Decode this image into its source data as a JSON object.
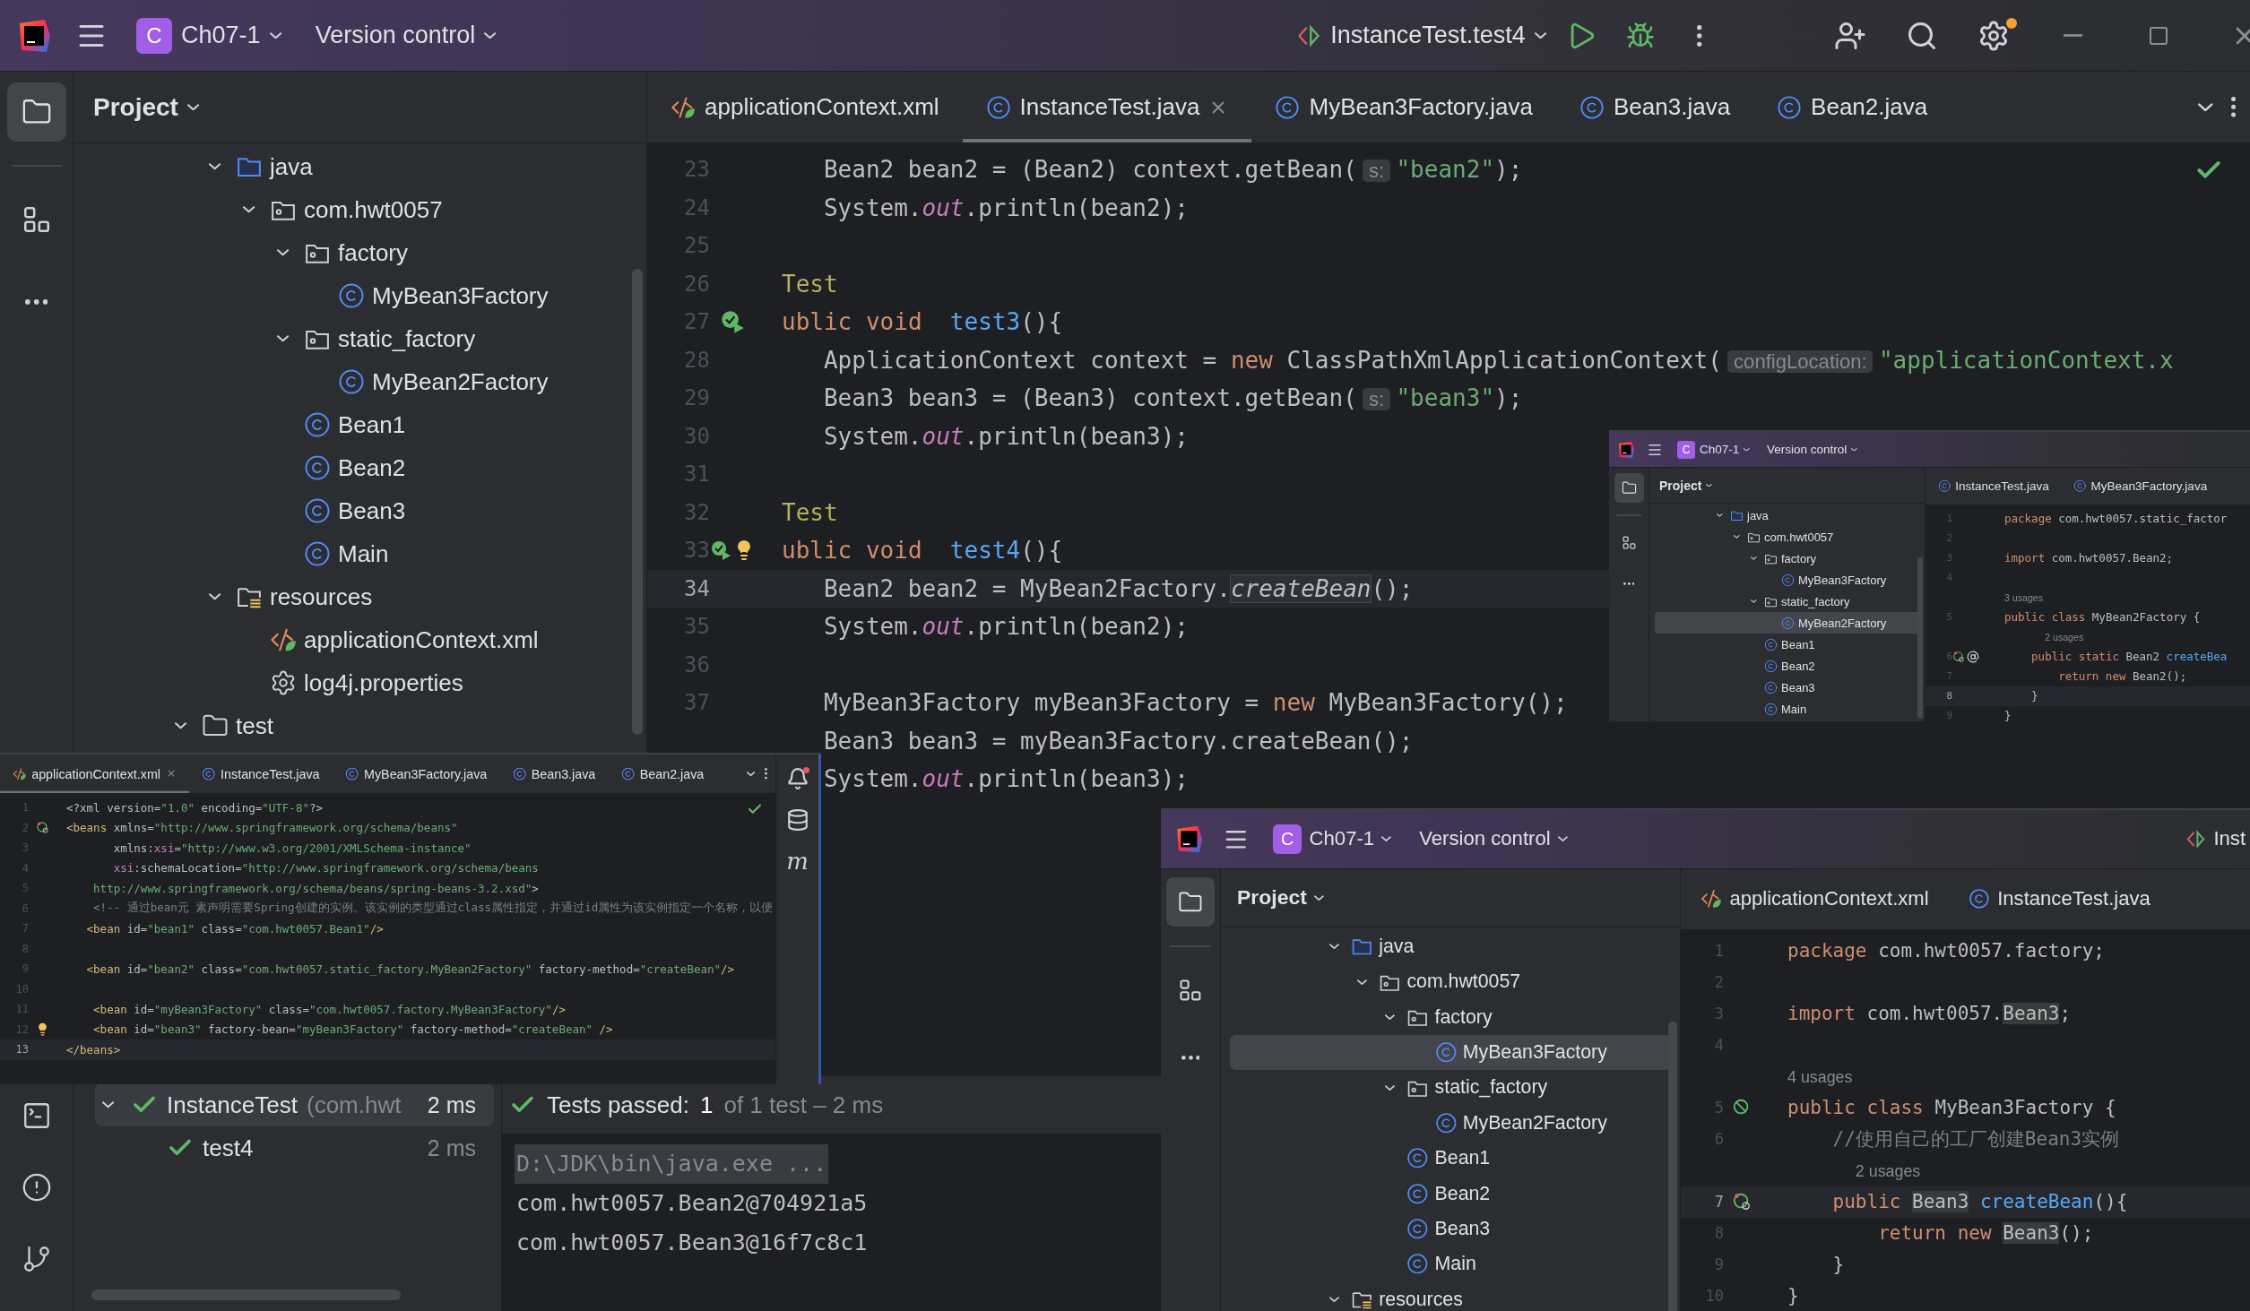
{
  "title_bar": {
    "project_badge": "C",
    "project": "Ch07-1",
    "vcs": "Version control",
    "run_config": "InstanceTest.test4"
  },
  "project_panel": {
    "title": "Project",
    "tree": [
      {
        "children": [
          {
            "label": "java",
            "kind": "source_folder",
            "expanded": true,
            "selected": false,
            "children": [
              {
                "label": "com.hwt0057",
                "kind": "package",
                "expanded": true,
                "selected": false,
                "children": [
                  {
                    "label": "factory",
                    "kind": "package",
                    "expanded": true,
                    "selected": false,
                    "children": [
                      {
                        "label": "MyBean3Factory",
                        "kind": "class",
                        "selected": false
                      }
                    ]
                  },
                  {
                    "label": "static_factory",
                    "kind": "package",
                    "expanded": true,
                    "selected": false,
                    "children": [
                      {
                        "label": "MyBean2Factory",
                        "kind": "class",
                        "selected": false
                      }
                    ]
                  },
                  {
                    "label": "Bean1",
                    "kind": "class",
                    "selected": false
                  },
                  {
                    "label": "Bean2",
                    "kind": "class",
                    "selected": false
                  },
                  {
                    "label": "Bean3",
                    "kind": "class",
                    "selected": false
                  },
                  {
                    "label": "Main",
                    "kind": "class",
                    "selected": false
                  }
                ]
              }
            ]
          },
          {
            "label": "resources",
            "kind": "resource_folder",
            "expanded": true,
            "selected": false,
            "children": [
              {
                "label": "applicationContext.xml",
                "kind": "xml",
                "selected": false
              },
              {
                "label": "log4j.properties",
                "kind": "properties",
                "selected": false
              }
            ]
          }
        ]
      },
      {
        "label": "test",
        "kind": "folder",
        "expanded": true,
        "selected": false
      }
    ]
  },
  "editor": {
    "tabs": [
      {
        "label": "applicationContext.xml",
        "kind": "xml",
        "selected": false
      },
      {
        "label": "InstanceTest.java",
        "kind": "class",
        "selected": true
      },
      {
        "label": "MyBean3Factory.java",
        "kind": "class",
        "selected": false
      },
      {
        "label": "Bean3.java",
        "kind": "class",
        "selected": false
      },
      {
        "label": "Bean2.java",
        "kind": "class",
        "selected": false
      }
    ],
    "lines": [
      {
        "number": "23",
        "current": false,
        "tokens": [
          {
            "kind": "plain",
            "text": "   Bean2 bean2 = (Bean2) context.getBean("
          },
          {
            "kind": "hint",
            "text": "s:"
          },
          {
            "kind": "str",
            "text": "\"bean2\""
          },
          {
            "kind": "plain",
            "text": ");"
          }
        ]
      },
      {
        "number": "24",
        "current": false,
        "tokens": [
          {
            "kind": "plain",
            "text": "   System."
          },
          {
            "kind": "field",
            "text": "out"
          },
          {
            "kind": "plain",
            "text": ".println(bean2);"
          }
        ]
      },
      {
        "number": "25",
        "current": false
      },
      {
        "number": "26",
        "current": false,
        "tokens": [
          {
            "kind": "ann",
            "text": "Test"
          }
        ]
      },
      {
        "number": "27",
        "current": false,
        "markers": [
          {
            "kind": "run"
          }
        ],
        "tokens": [
          {
            "kind": "kw",
            "text": "ublic void  "
          },
          {
            "kind": "decl",
            "text": "test3"
          },
          {
            "kind": "plain",
            "text": "(){"
          }
        ]
      },
      {
        "number": "28",
        "current": false,
        "tokens": [
          {
            "kind": "plain",
            "text": "   ApplicationContext context = "
          },
          {
            "kind": "kw",
            "text": "new "
          },
          {
            "kind": "plain",
            "text": "ClassPathXmlApplicationContext("
          },
          {
            "kind": "hint",
            "text": "configLocation:"
          },
          {
            "kind": "str",
            "text": "\"applicationContext.x"
          }
        ]
      },
      {
        "number": "29",
        "current": false,
        "tokens": [
          {
            "kind": "plain",
            "text": "   Bean3 bean3 = (Bean3) context.getBean("
          },
          {
            "kind": "hint",
            "text": "s:"
          },
          {
            "kind": "str",
            "text": "\"bean3\""
          },
          {
            "kind": "plain",
            "text": ");"
          }
        ]
      },
      {
        "number": "30",
        "current": false,
        "tokens": [
          {
            "kind": "plain",
            "text": "   System."
          },
          {
            "kind": "field",
            "text": "out"
          },
          {
            "kind": "plain",
            "text": ".println(bean3);"
          }
        ]
      },
      {
        "number": "31",
        "current": false
      },
      {
        "number": "32",
        "current": false,
        "tokens": [
          {
            "kind": "ann",
            "text": "Test"
          }
        ]
      },
      {
        "number": "33",
        "current": false,
        "markers": [
          {
            "kind": "run"
          },
          {
            "kind": "bulb"
          }
        ],
        "tokens": [
          {
            "kind": "kw",
            "text": "ublic void  "
          },
          {
            "kind": "decl",
            "text": "test4"
          },
          {
            "kind": "plain",
            "text": "(){"
          }
        ]
      },
      {
        "number": "34",
        "current": true,
        "tokens": [
          {
            "kind": "plain",
            "text": "   Bean2 bean2 = MyBean2Factory."
          },
          {
            "kind": "call",
            "text": "createBean"
          },
          {
            "kind": "plain",
            "text": "();"
          }
        ]
      },
      {
        "number": "35",
        "current": false,
        "tokens": [
          {
            "kind": "plain",
            "text": "   System."
          },
          {
            "kind": "field",
            "text": "out"
          },
          {
            "kind": "plain",
            "text": ".println(bean2);"
          }
        ]
      },
      {
        "number": "36",
        "current": false
      },
      {
        "number": "37",
        "current": false,
        "tokens": [
          {
            "kind": "plain",
            "text": "   MyBean3Factory myBean3Factory = "
          },
          {
            "kind": "kw",
            "text": "new "
          },
          {
            "kind": "plain",
            "text": "MyBean3Factory();"
          }
        ]
      },
      {
        "current": false,
        "tokens": [
          {
            "kind": "plain",
            "text": "   Bean3 bean3 = myBean3Factory.createBean();"
          }
        ]
      },
      {
        "current": false,
        "tokens": [
          {
            "kind": "plain",
            "text": "   System."
          },
          {
            "kind": "field",
            "text": "out"
          },
          {
            "kind": "plain",
            "text": ".println(bean3);"
          }
        ]
      }
    ]
  },
  "run_panel": {
    "tree": [
      {
        "label": "InstanceTest",
        "detail": "(com.hwt",
        "time": "2 ms",
        "passed": true,
        "expanded": true,
        "selected": true,
        "children": [
          {
            "label": "test4",
            "time": "2 ms",
            "passed": true,
            "selected": false
          }
        ]
      }
    ],
    "status": {
      "label": "Tests passed:",
      "count": "1",
      "detail": "of 1 test – 2 ms"
    },
    "console": [
      {
        "kind": "command",
        "text": "D:\\JDK\\bin\\java.exe ..."
      },
      {
        "kind": "output",
        "text": "com.hwt0057.Bean2@704921a5"
      },
      {
        "kind": "output",
        "text": "com.hwt0057.Bean3@16f7c8c1"
      }
    ]
  },
  "floating_windows": [
    {
      "kind": "ide",
      "title_bar": {
        "project_badge": "C",
        "project": "Ch07-1",
        "vcs": "Version control"
      },
      "project_panel": {
        "title": "Project",
        "tree": [
          {
            "label": "java",
            "kind": "source_folder",
            "expanded": true,
            "selected": false,
            "children": [
              {
                "label": "com.hwt0057",
                "kind": "package",
                "expanded": true,
                "selected": false,
                "children": [
                  {
                    "label": "factory",
                    "kind": "package",
                    "expanded": true,
                    "selected": false,
                    "children": [
                      {
                        "label": "MyBean3Factory",
                        "kind": "class",
                        "selected": false
                      }
                    ]
                  },
                  {
                    "label": "static_factory",
                    "kind": "package",
                    "expanded": true,
                    "selected": false,
                    "children": [
                      {
                        "label": "MyBean2Factory",
                        "kind": "class",
                        "selected": true
                      }
                    ]
                  },
                  {
                    "label": "Bean1",
                    "kind": "class",
                    "selected": false
                  },
                  {
                    "label": "Bean2",
                    "kind": "class",
                    "selected": false
                  },
                  {
                    "label": "Bean3",
                    "kind": "class",
                    "selected": false
                  },
                  {
                    "label": "Main",
                    "kind": "class",
                    "selected": false
                  }
                ]
              }
            ]
          }
        ]
      },
      "tabs": [
        {
          "label": "InstanceTest.java",
          "kind": "class",
          "selected": false
        },
        {
          "label": "MyBean3Factory.java",
          "kind": "class",
          "selected": false
        }
      ],
      "lines": [
        {
          "number": "1",
          "current": false,
          "tokens": [
            {
              "kind": "kw",
              "text": "package "
            },
            {
              "kind": "plain",
              "text": "com.hwt0057.static_factor"
            }
          ]
        },
        {
          "number": "2",
          "current": false
        },
        {
          "number": "3",
          "current": false,
          "tokens": [
            {
              "kind": "kw",
              "text": "import "
            },
            {
              "kind": "plain",
              "text": "com.hwt0057.Bean2;"
            }
          ]
        },
        {
          "number": "4",
          "current": false
        },
        {
          "current": false,
          "tokens": [
            {
              "kind": "usages",
              "text": "3 usages"
            }
          ]
        },
        {
          "number": "5",
          "current": false,
          "tokens": [
            {
              "kind": "kw",
              "text": "public class "
            },
            {
              "kind": "plain",
              "text": "MyBean2Factory {"
            }
          ]
        },
        {
          "current": false,
          "tokens": [
            {
              "kind": "usages",
              "text": "      2 usages"
            }
          ]
        },
        {
          "number": "6",
          "current": false,
          "markers": [
            {
              "kind": "bean"
            },
            {
              "kind": "at"
            }
          ],
          "tokens": [
            {
              "kind": "kw",
              "text": "    public static "
            },
            {
              "kind": "plain",
              "text": "Bean2 "
            },
            {
              "kind": "decl",
              "text": "createBea"
            }
          ]
        },
        {
          "number": "7",
          "current": false,
          "tokens": [
            {
              "kind": "kw",
              "text": "        return new "
            },
            {
              "kind": "plain",
              "text": "Bean2();"
            }
          ]
        },
        {
          "number": "8",
          "current": true,
          "tokens": [
            {
              "kind": "plain",
              "text": "    }"
            }
          ]
        },
        {
          "number": "9",
          "current": false,
          "tokens": [
            {
              "kind": "plain",
              "text": "}"
            }
          ]
        }
      ]
    },
    {
      "kind": "editor",
      "tabs": [
        {
          "label": "applicationContext.xml",
          "kind": "xml",
          "selected": true
        },
        {
          "label": "InstanceTest.java",
          "kind": "class",
          "selected": false
        },
        {
          "label": "MyBean3Factory.java",
          "kind": "class",
          "selected": false
        },
        {
          "label": "Bean3.java",
          "kind": "class",
          "selected": false
        },
        {
          "label": "Bean2.java",
          "kind": "class",
          "selected": false
        }
      ],
      "maven_glyph": "m",
      "lines": [
        {
          "number": "1",
          "current": false,
          "tokens": [
            {
              "kind": "plain",
              "text": "<?xml version="
            },
            {
              "kind": "str",
              "text": "\"1.0\""
            },
            {
              "kind": "plain",
              "text": " encoding="
            },
            {
              "kind": "str",
              "text": "\"UTF-8\""
            },
            {
              "kind": "plain",
              "text": "?>"
            }
          ]
        },
        {
          "number": "2",
          "current": false,
          "markers": [
            {
              "kind": "bean"
            }
          ],
          "tokens": [
            {
              "kind": "tag",
              "text": "<beans"
            },
            {
              "kind": "plain",
              "text": " xmlns="
            },
            {
              "kind": "str",
              "text": "\"http://www.springframework.org/schema/beans\""
            }
          ]
        },
        {
          "number": "3",
          "current": false,
          "tokens": [
            {
              "kind": "plain",
              "text": "       xmlns:"
            },
            {
              "kind": "ns",
              "text": "xsi"
            },
            {
              "kind": "plain",
              "text": "="
            },
            {
              "kind": "str",
              "text": "\"http://www.w3.org/2001/XMLSchema-instance\""
            }
          ]
        },
        {
          "number": "4",
          "current": false,
          "tokens": [
            {
              "kind": "ns",
              "text": "       xsi"
            },
            {
              "kind": "plain",
              "text": ":schemaLocation="
            },
            {
              "kind": "str",
              "text": "\"http://www.springframework.org/schema/beans"
            }
          ]
        },
        {
          "number": "5",
          "current": false,
          "tokens": [
            {
              "kind": "str",
              "text": "    http://www.springframework.org/schema/beans/spring-beans-3.2.xsd\""
            },
            {
              "kind": "plain",
              "text": ">"
            }
          ]
        },
        {
          "number": "6",
          "current": false,
          "tokens": [
            {
              "kind": "comment",
              "text": "    <!-- 通过bean元 素声明需要Spring创建的实例。该实例的类型通过class属性指定，并通过id属性为该实例指定一个名称，以便"
            }
          ]
        },
        {
          "number": "7",
          "current": false,
          "tokens": [
            {
              "kind": "tag",
              "text": "   <bean "
            },
            {
              "kind": "plain",
              "text": "id="
            },
            {
              "kind": "str",
              "text": "\"bean1\""
            },
            {
              "kind": "plain",
              "text": " class="
            },
            {
              "kind": "str",
              "text": "\"com.hwt0057.Bean1\""
            },
            {
              "kind": "tag",
              "text": "/>"
            }
          ]
        },
        {
          "number": "8",
          "current": false
        },
        {
          "number": "9",
          "current": false,
          "tokens": [
            {
              "kind": "tag",
              "text": "   <bean "
            },
            {
              "kind": "plain",
              "text": "id="
            },
            {
              "kind": "str",
              "text": "\"bean2\""
            },
            {
              "kind": "plain",
              "text": " class="
            },
            {
              "kind": "str",
              "text": "\"com.hwt0057.static_factory.MyBean2Factory\""
            },
            {
              "kind": "plain",
              "text": " factory-method="
            },
            {
              "kind": "str",
              "text": "\"createBean\""
            },
            {
              "kind": "tag",
              "text": "/>"
            }
          ]
        },
        {
          "number": "10",
          "current": false
        },
        {
          "number": "11",
          "current": false,
          "tokens": [
            {
              "kind": "tag",
              "text": "    <bean "
            },
            {
              "kind": "plain",
              "text": "id="
            },
            {
              "kind": "str",
              "text": "\"myBean3Factory\""
            },
            {
              "kind": "plain",
              "text": " class="
            },
            {
              "kind": "str",
              "text": "\"com.hwt0057.factory.MyBean3Factory\""
            },
            {
              "kind": "tag",
              "text": "/>"
            }
          ]
        },
        {
          "number": "12",
          "current": false,
          "markers": [
            {
              "kind": "bulb"
            }
          ],
          "tokens": [
            {
              "kind": "tag",
              "text": "    <bean "
            },
            {
              "kind": "plain",
              "text": "id="
            },
            {
              "kind": "str",
              "text": "\"bean3\""
            },
            {
              "kind": "plain",
              "text": " factory-bean="
            },
            {
              "kind": "str",
              "text": "\"myBean3Factory\""
            },
            {
              "kind": "plain",
              "text": " factory-method="
            },
            {
              "kind": "str",
              "text": "\"createBean\""
            },
            {
              "kind": "tag",
              "text": " />"
            }
          ]
        },
        {
          "number": "13",
          "current": true,
          "tokens": [
            {
              "kind": "tag",
              "text": "</beans>"
            }
          ]
        }
      ]
    },
    {
      "kind": "ide",
      "title_bar": {
        "project_badge": "C",
        "project": "Ch07-1",
        "vcs": "Version control",
        "run_config": "Inst"
      },
      "project_panel": {
        "title": "Project",
        "tree": [
          {
            "label": "java",
            "kind": "source_folder",
            "expanded": true,
            "selected": false,
            "children": [
              {
                "label": "com.hwt0057",
                "kind": "package",
                "expanded": true,
                "selected": false,
                "children": [
                  {
                    "label": "factory",
                    "kind": "package",
                    "expanded": true,
                    "selected": false,
                    "children": [
                      {
                        "label": "MyBean3Factory",
                        "kind": "class",
                        "selected": true
                      }
                    ]
                  },
                  {
                    "label": "static_factory",
                    "kind": "package",
                    "expanded": true,
                    "selected": false,
                    "children": [
                      {
                        "label": "MyBean2Factory",
                        "kind": "class",
                        "selected": false
                      }
                    ]
                  },
                  {
                    "label": "Bean1",
                    "kind": "class",
                    "selected": false
                  },
                  {
                    "label": "Bean2",
                    "kind": "class",
                    "selected": false
                  },
                  {
                    "label": "Bean3",
                    "kind": "class",
                    "selected": false
                  },
                  {
                    "label": "Main",
                    "kind": "class",
                    "selected": false
                  }
                ]
              }
            ]
          },
          {
            "label": "resources",
            "kind": "resource_folder",
            "expanded": true,
            "selected": false
          }
        ]
      },
      "tabs": [
        {
          "label": "applicationContext.xml",
          "kind": "xml",
          "selected": false
        },
        {
          "label": "InstanceTest.java",
          "kind": "class",
          "selected": false
        }
      ],
      "lines": [
        {
          "number": "1",
          "current": false,
          "tokens": [
            {
              "kind": "kw",
              "text": "package "
            },
            {
              "kind": "plain",
              "text": "com.hwt0057.factory;"
            }
          ]
        },
        {
          "number": "2",
          "current": false
        },
        {
          "number": "3",
          "current": false,
          "tokens": [
            {
              "kind": "kw",
              "text": "import "
            },
            {
              "kind": "plain",
              "text": "com.hwt0057."
            },
            {
              "kind": "ref",
              "text": "Bean3"
            },
            {
              "kind": "plain",
              "text": ";"
            }
          ]
        },
        {
          "number": "4",
          "current": false
        },
        {
          "current": false,
          "tokens": [
            {
              "kind": "usages",
              "text": "4 usages"
            }
          ]
        },
        {
          "number": "5",
          "current": false,
          "markers": [
            {
              "kind": "bean_off"
            }
          ],
          "tokens": [
            {
              "kind": "kw",
              "text": "public class "
            },
            {
              "kind": "plain",
              "text": "MyBean3Factory {"
            }
          ]
        },
        {
          "number": "6",
          "current": false,
          "tokens": [
            {
              "kind": "comment",
              "text": "    //使用自己的工厂创建Bean3实例"
            }
          ]
        },
        {
          "current": false,
          "tokens": [
            {
              "kind": "usages",
              "text": "      2 usages"
            }
          ]
        },
        {
          "number": "7",
          "current": true,
          "markers": [
            {
              "kind": "bean"
            }
          ],
          "tokens": [
            {
              "kind": "kw",
              "text": "    public "
            },
            {
              "kind": "ref",
              "text": "Bean3"
            },
            {
              "kind": "decl",
              "text": " createBean"
            },
            {
              "kind": "plain",
              "text": "(){"
            }
          ]
        },
        {
          "number": "8",
          "current": false,
          "tokens": [
            {
              "kind": "kw",
              "text": "        return new "
            },
            {
              "kind": "ref",
              "text": "Bean3"
            },
            {
              "kind": "plain",
              "text": "();"
            }
          ]
        },
        {
          "number": "9",
          "current": false,
          "tokens": [
            {
              "kind": "plain",
              "text": "    }"
            }
          ]
        },
        {
          "number": "10",
          "current": false,
          "tokens": [
            {
              "kind": "plain",
              "text": "}"
            }
          ]
        }
      ]
    }
  ]
}
